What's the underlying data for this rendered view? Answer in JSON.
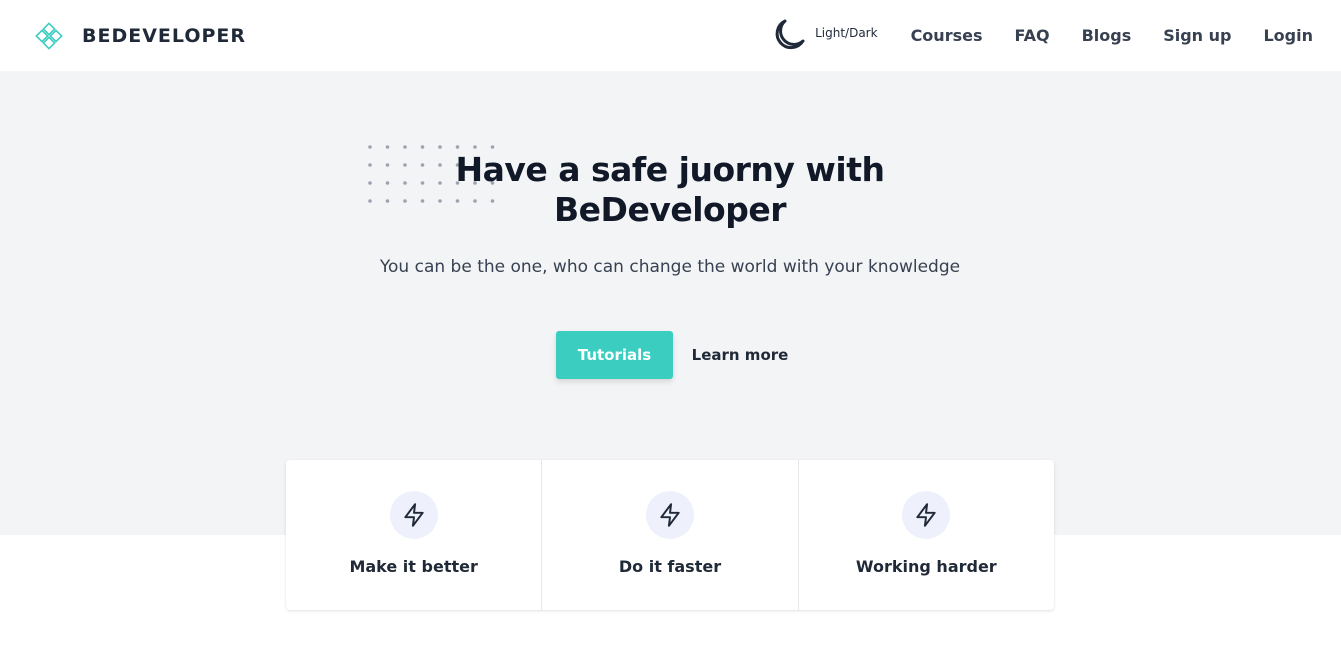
{
  "brand": {
    "name": "BEDEVELOPER",
    "icon": "diamond-grid-logo-icon",
    "accent": "#3bcdbf"
  },
  "header": {
    "theme_toggle": {
      "label": "Light/Dark",
      "icon": "moon-icon"
    },
    "nav": [
      "Courses",
      "FAQ",
      "Blogs",
      "Sign up",
      "Login"
    ]
  },
  "hero": {
    "title_line1": "Have a safe juorny with",
    "title_line2": "BeDeveloper",
    "subtitle": "You can be the one, who can change the world with your knowledge",
    "primary_button": "Tutorials",
    "secondary_button": "Learn more",
    "background": "#f3f4f6"
  },
  "features": [
    {
      "label": "Make it better",
      "icon": "lightning-bolt-icon"
    },
    {
      "label": "Do it faster",
      "icon": "lightning-bolt-icon"
    },
    {
      "label": "Working harder",
      "icon": "lightning-bolt-icon"
    }
  ]
}
